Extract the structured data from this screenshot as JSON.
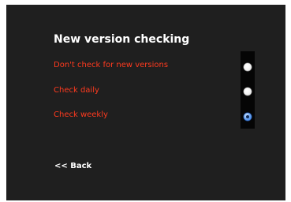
{
  "title": "New version checking",
  "options": [
    {
      "label": "Don't check for new versions",
      "selected": false
    },
    {
      "label": "Check daily",
      "selected": false
    },
    {
      "label": "Check weekly",
      "selected": true
    }
  ],
  "back_label": "<< Back",
  "colors": {
    "background": "#1f1f1f",
    "option_text": "#ff3a1f",
    "title_text": "#ffffff",
    "selected_radio": "#5e9df0"
  }
}
